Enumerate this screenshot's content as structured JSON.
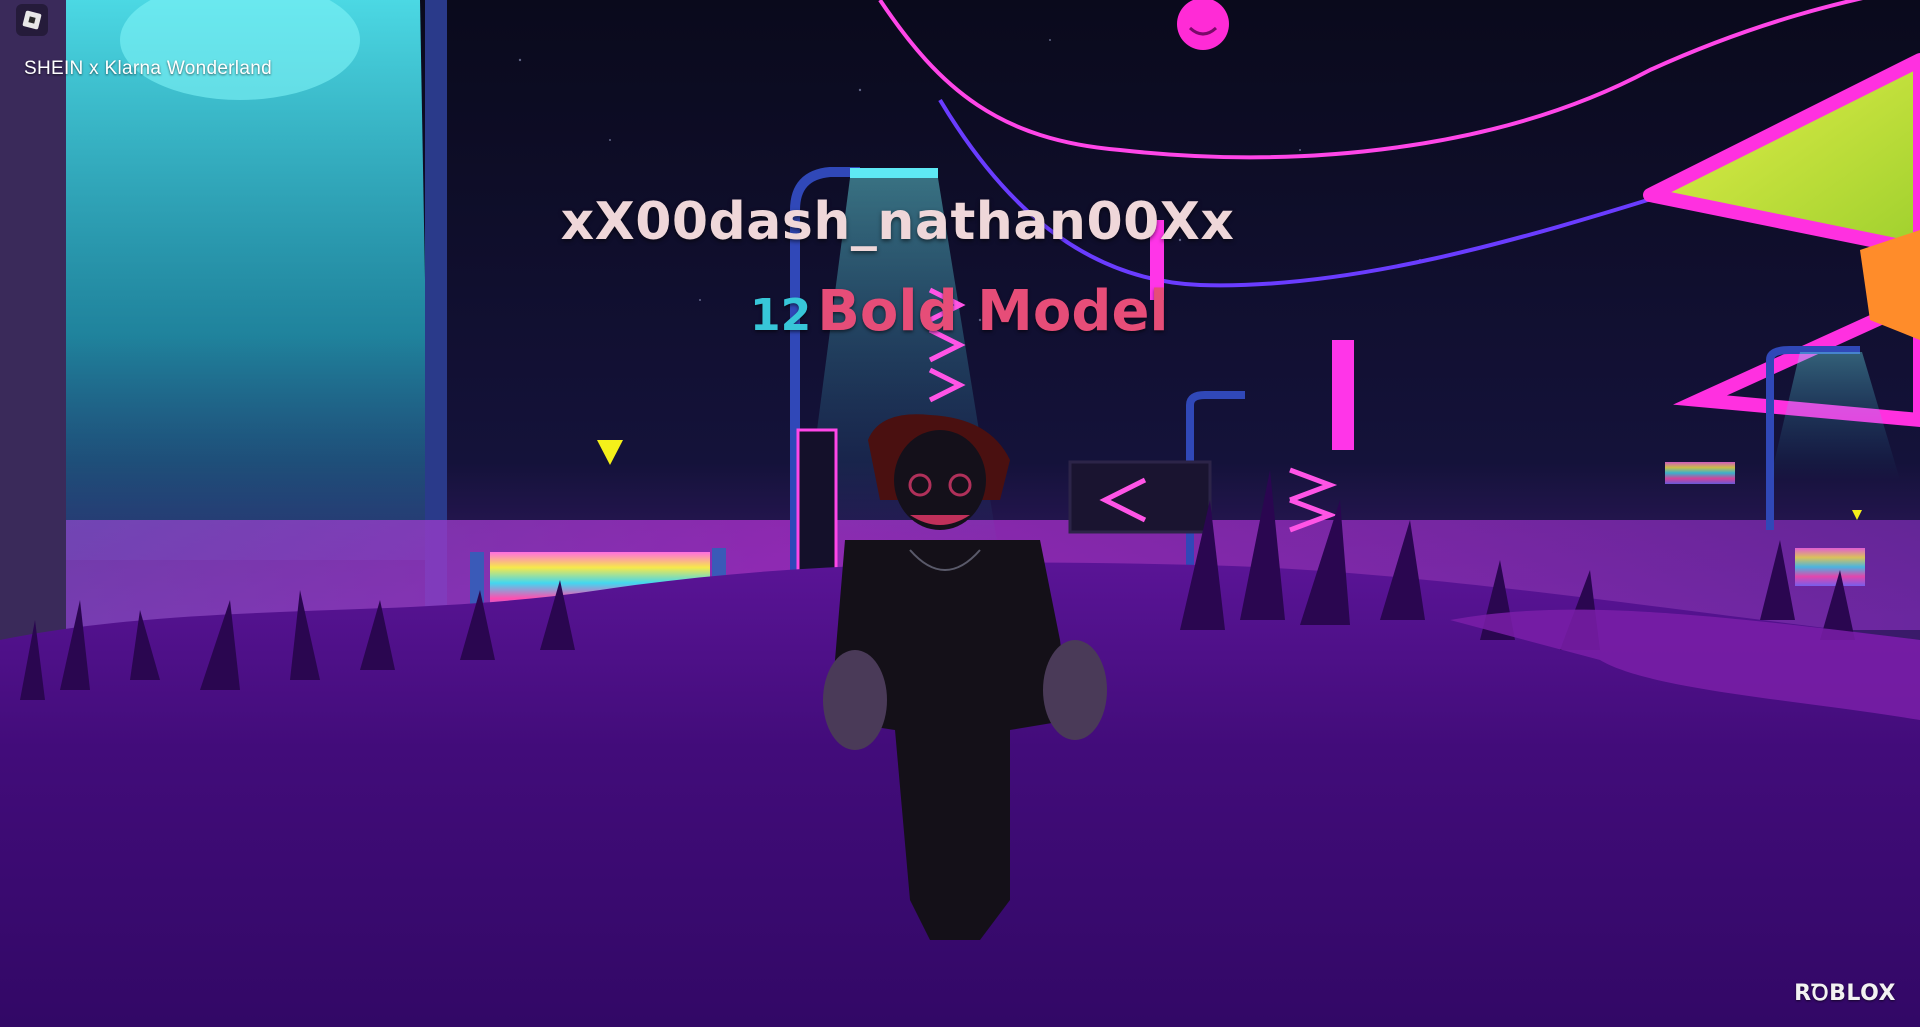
{
  "hud": {
    "menu_icon": "roblox-menu-icon",
    "experience_title": "SHEIN x Klarna Wonderland"
  },
  "player": {
    "name": "xX00dash_nathan00Xx",
    "level": "12",
    "rank_title": "Bold Model"
  },
  "branding": {
    "logo_text": "RꝹBLOX"
  },
  "colors": {
    "player_name": "#efd7d9",
    "level": "#37c6d8",
    "rank_title": "#e64d78",
    "grass": "#3c0a6e",
    "neon_pink": "#ff2bd6",
    "neon_cyan": "#2fd6e6",
    "sky": "#0b0a1e"
  }
}
